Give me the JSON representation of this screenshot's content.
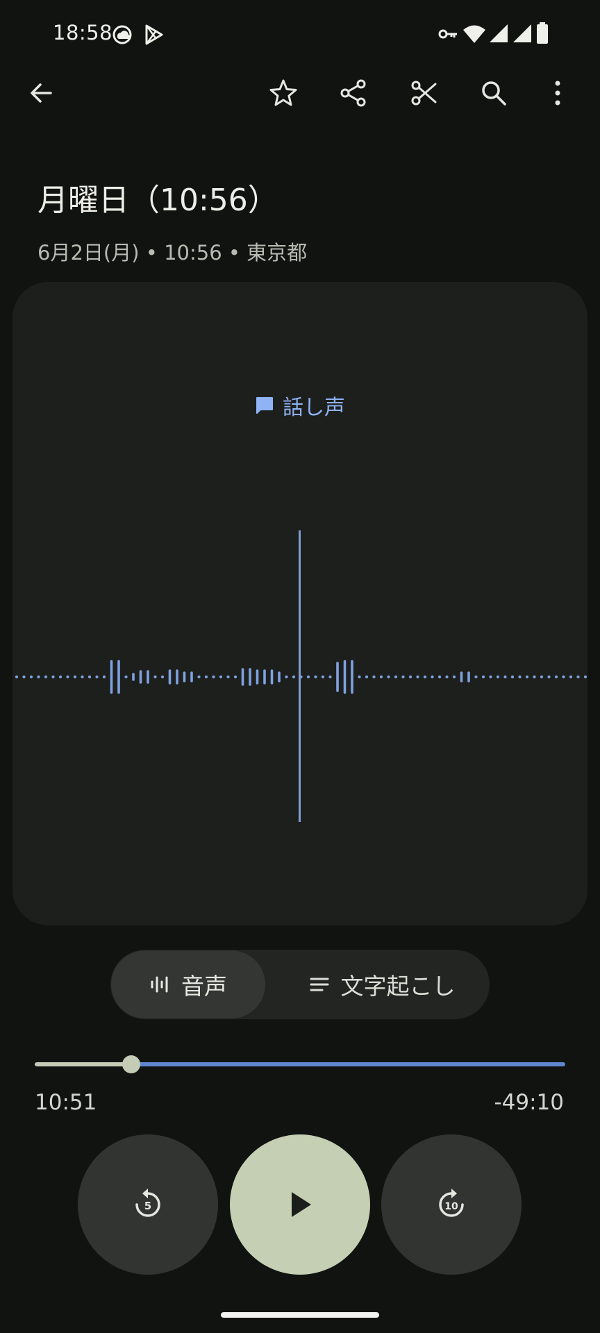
{
  "status_bar": {
    "time": "18:58",
    "icons": [
      "cloud-app-icon",
      "play-store-icon",
      "vpn-key-icon",
      "wifi-icon",
      "signal-icon",
      "signal-icon",
      "battery-icon"
    ]
  },
  "toolbar": {
    "icons": [
      "back-arrow-icon",
      "star-icon",
      "share-icon",
      "scissors-icon",
      "search-icon",
      "more-vert-icon"
    ]
  },
  "recording": {
    "title": "月曜日（10:56）",
    "subtitle": "6月2日(月) • 10:56 • 東京都"
  },
  "waveform": {
    "speaker_label": "話し声",
    "accent_color": "#8fb3f5"
  },
  "view_toggle": {
    "audio_label": "音声",
    "transcript_label": "文字起こし",
    "selected": "audio"
  },
  "progress": {
    "elapsed": "10:51",
    "remaining": "-49:10",
    "fraction": 0.18
  },
  "controls": {
    "rewind_seconds": "5",
    "forward_seconds": "10"
  }
}
